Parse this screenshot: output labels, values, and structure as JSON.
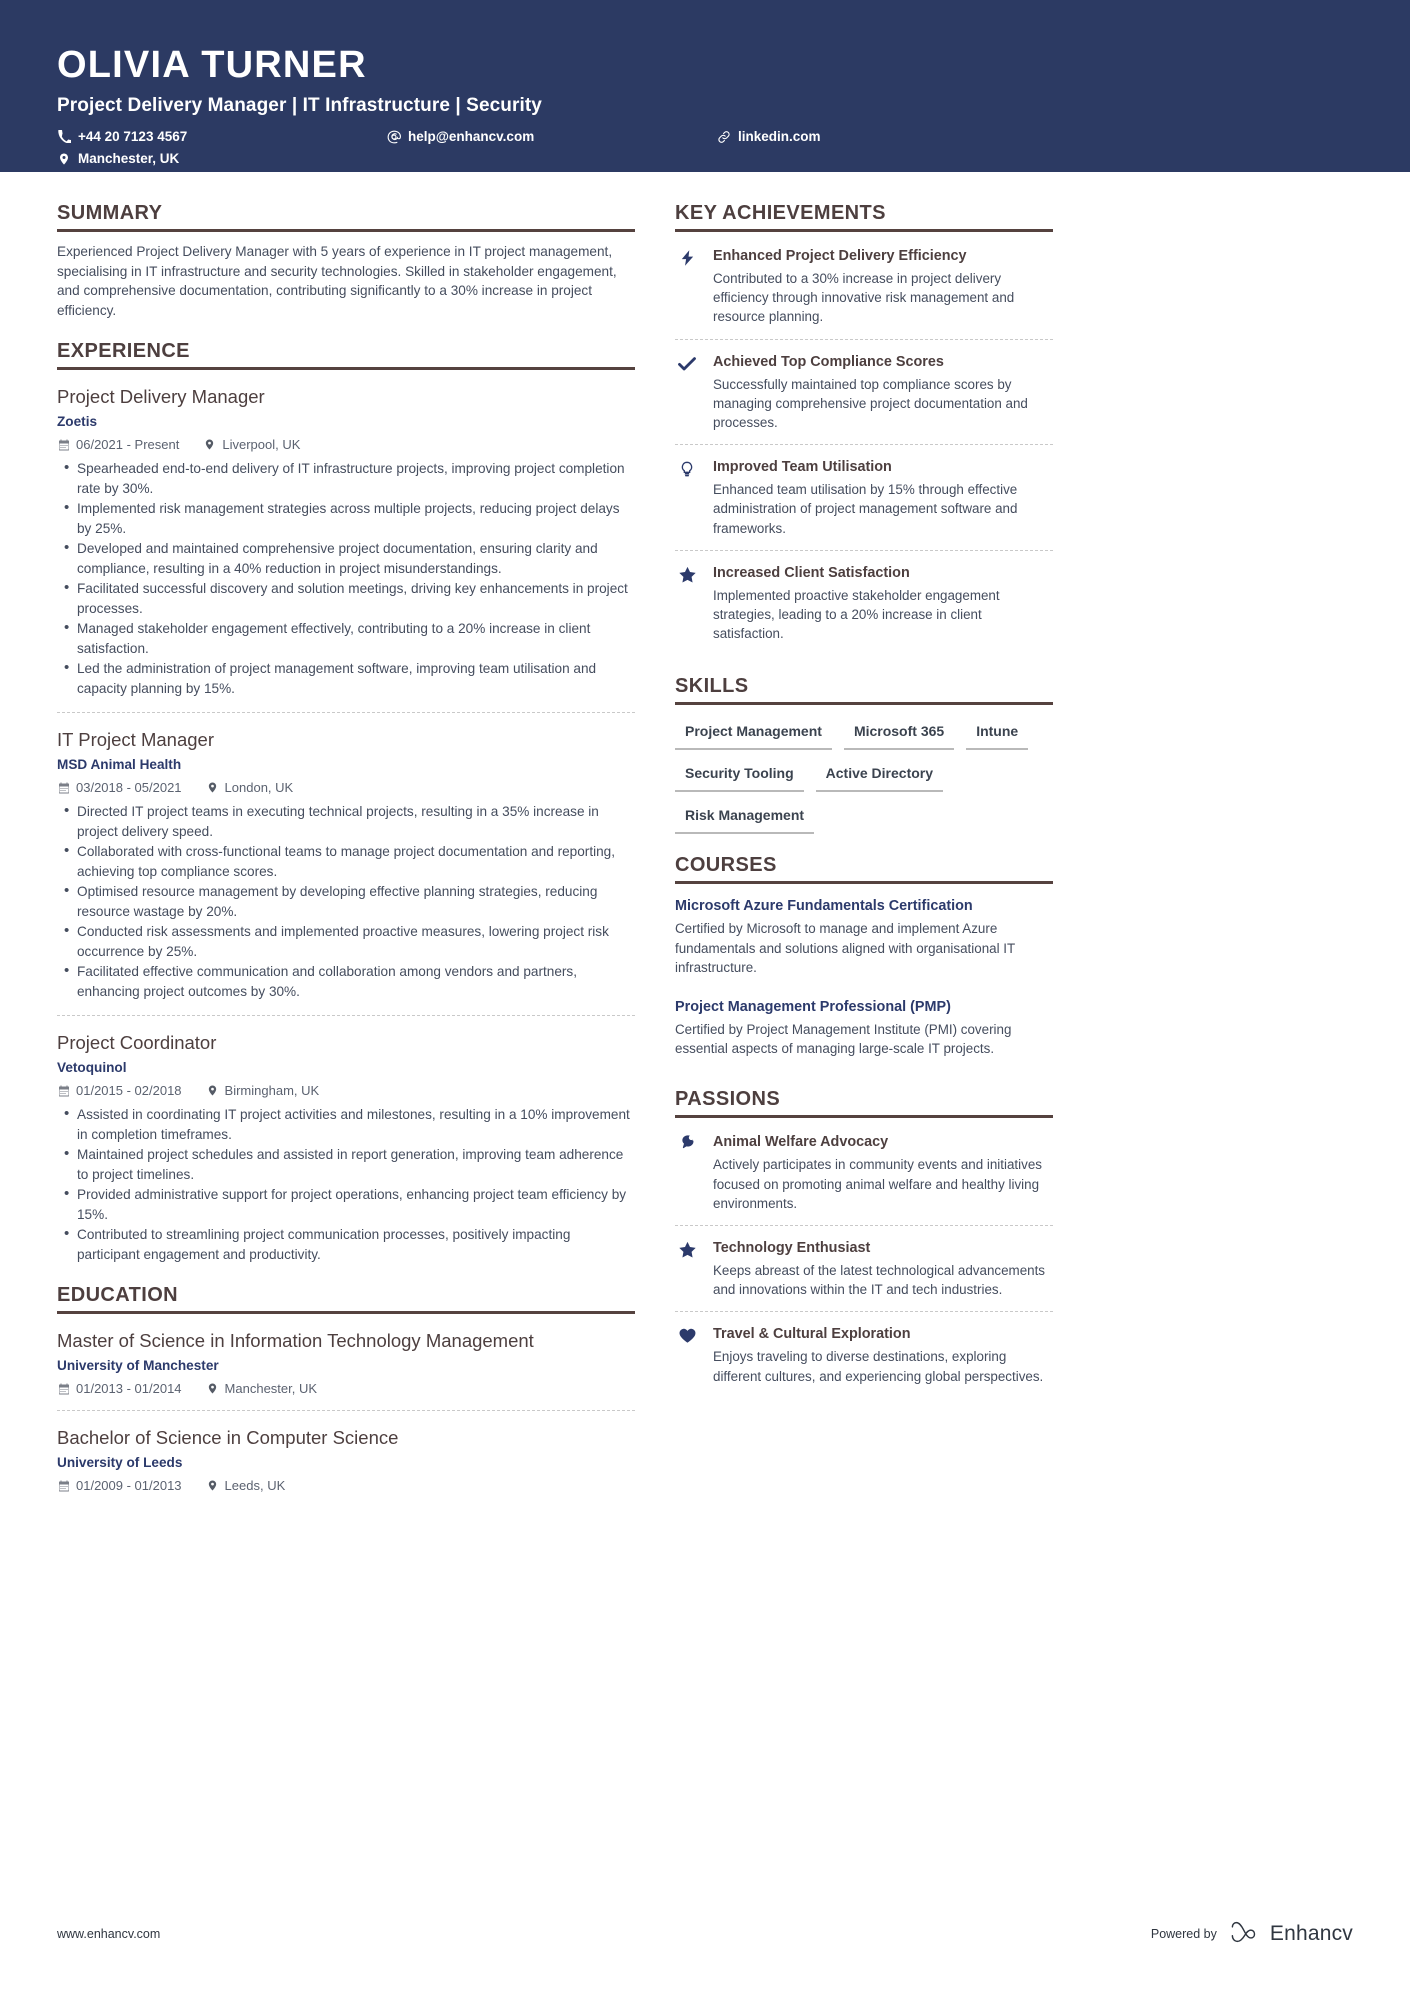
{
  "colors": {
    "header_bg": "#2c3a63",
    "accent_navy": "#2c3a6b",
    "heading_brown": "#4d3f3f",
    "rule_brown": "#55423f",
    "body_gray": "#454d5e"
  },
  "header": {
    "name": "OLIVIA TURNER",
    "headline": "Project Delivery Manager | IT Infrastructure | Security",
    "contacts": [
      {
        "icon": "phone-icon",
        "text": "+44 20 7123 4567"
      },
      {
        "icon": "email-icon",
        "text": "help@enhancv.com"
      },
      {
        "icon": "link-icon",
        "text": "linkedin.com"
      },
      {
        "icon": "location-pin-icon",
        "text": "Manchester, UK"
      }
    ]
  },
  "left": {
    "summary": {
      "title": "SUMMARY",
      "text": "Experienced Project Delivery Manager with 5 years of experience in IT project management, specialising in IT infrastructure and security technologies. Skilled in stakeholder engagement, and comprehensive documentation, contributing significantly to a 30% increase in project efficiency."
    },
    "experience": {
      "title": "EXPERIENCE",
      "entries": [
        {
          "role": "Project Delivery Manager",
          "company": "Zoetis",
          "dates": "06/2021 - Present",
          "location": "Liverpool, UK",
          "bullets": [
            "Spearheaded end-to-end delivery of IT infrastructure projects, improving project completion rate by 30%.",
            "Implemented risk management strategies across multiple projects, reducing project delays by 25%.",
            "Developed and maintained comprehensive project documentation, ensuring clarity and compliance, resulting in a 40% reduction in project misunderstandings.",
            "Facilitated successful discovery and solution meetings, driving key enhancements in project processes.",
            "Managed stakeholder engagement effectively, contributing to a 20% increase in client satisfaction.",
            "Led the administration of project management software, improving team utilisation and capacity planning by 15%."
          ]
        },
        {
          "role": "IT Project Manager",
          "company": "MSD Animal Health",
          "dates": "03/2018 - 05/2021",
          "location": "London, UK",
          "bullets": [
            "Directed IT project teams in executing technical projects, resulting in a 35% increase in project delivery speed.",
            "Collaborated with cross-functional teams to manage project documentation and reporting, achieving top compliance scores.",
            "Optimised resource management by developing effective planning strategies, reducing resource wastage by 20%.",
            "Conducted risk assessments and implemented proactive measures, lowering project risk occurrence by 25%.",
            "Facilitated effective communication and collaboration among vendors and partners, enhancing project outcomes by 30%."
          ]
        },
        {
          "role": "Project Coordinator",
          "company": "Vetoquinol",
          "dates": "01/2015 - 02/2018",
          "location": "Birmingham, UK",
          "bullets": [
            "Assisted in coordinating IT project activities and milestones, resulting in a 10% improvement in completion timeframes.",
            "Maintained project schedules and assisted in report generation, improving team adherence to project timelines.",
            "Provided administrative support for project operations, enhancing project team efficiency by 15%.",
            "Contributed to streamlining project communication processes, positively impacting participant engagement and productivity."
          ]
        }
      ]
    },
    "education": {
      "title": "EDUCATION",
      "entries": [
        {
          "degree": "Master of Science in Information Technology Management",
          "school": "University of Manchester",
          "dates": "01/2013 - 01/2014",
          "location": "Manchester, UK"
        },
        {
          "degree": "Bachelor of Science in Computer Science",
          "school": "University of Leeds",
          "dates": "01/2009 - 01/2013",
          "location": "Leeds, UK"
        }
      ]
    }
  },
  "right": {
    "achievements": {
      "title": "KEY ACHIEVEMENTS",
      "items": [
        {
          "icon": "lightning-bolt-icon",
          "title": "Enhanced Project Delivery Efficiency",
          "desc": "Contributed to a 30% increase in project delivery efficiency through innovative risk management and resource planning."
        },
        {
          "icon": "check-icon",
          "title": "Achieved Top Compliance Scores",
          "desc": "Successfully maintained top compliance scores by managing comprehensive project documentation and processes."
        },
        {
          "icon": "lightbulb-icon",
          "title": "Improved Team Utilisation",
          "desc": "Enhanced team utilisation by 15% through effective administration of project management software and frameworks."
        },
        {
          "icon": "star-icon",
          "title": "Increased Client Satisfaction",
          "desc": "Implemented proactive stakeholder engagement strategies, leading to a 20% increase in client satisfaction."
        }
      ]
    },
    "skills": {
      "title": "SKILLS",
      "items": [
        "Project Management",
        "Microsoft 365",
        "Intune",
        "Security Tooling",
        "Active Directory",
        "Risk Management"
      ]
    },
    "courses": {
      "title": "COURSES",
      "items": [
        {
          "title": "Microsoft Azure Fundamentals Certification",
          "desc": "Certified by Microsoft to manage and implement Azure fundamentals and solutions aligned with organisational IT infrastructure."
        },
        {
          "title": "Project Management Professional (PMP)",
          "desc": "Certified by Project Management Institute (PMI) covering essential aspects of managing large-scale IT projects."
        }
      ]
    },
    "passions": {
      "title": "PASSIONS",
      "items": [
        {
          "icon": "paw-icon",
          "title": "Animal Welfare Advocacy",
          "desc": "Actively participates in community events and initiatives focused on promoting animal welfare and healthy living environments."
        },
        {
          "icon": "star-icon",
          "title": "Technology Enthusiast",
          "desc": "Keeps abreast of the latest technological advancements and innovations within the IT and tech industries."
        },
        {
          "icon": "heart-icon",
          "title": "Travel & Cultural Exploration",
          "desc": "Enjoys traveling to diverse destinations, exploring different cultures, and experiencing global perspectives."
        }
      ]
    }
  },
  "footer": {
    "url": "www.enhancv.com",
    "powered_label": "Powered by",
    "brand_name": "Enhancv"
  }
}
